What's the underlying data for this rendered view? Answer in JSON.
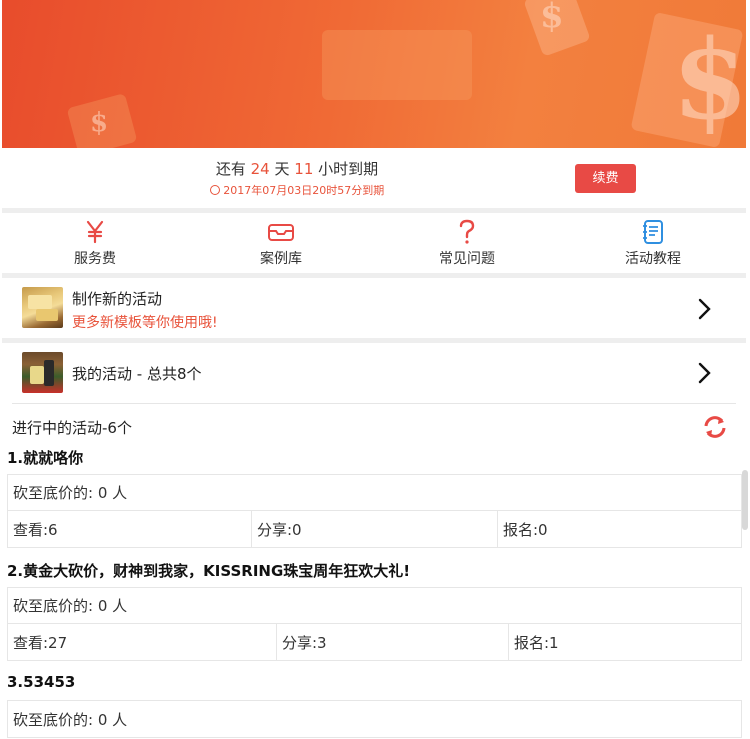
{
  "expiry": {
    "prefix": "还有",
    "days": "24",
    "day_unit": "天",
    "hours": "11",
    "suffix": "小时到期",
    "date_text": "2017年07月03日20时57分到期",
    "renew_label": "续费"
  },
  "nav": [
    {
      "label": "服务费",
      "icon": "yen-icon"
    },
    {
      "label": "案例库",
      "icon": "box-icon"
    },
    {
      "label": "常见问题",
      "icon": "question-icon"
    },
    {
      "label": "活动教程",
      "icon": "notebook-icon"
    }
  ],
  "create": {
    "title": "制作新的活动",
    "subtitle": "更多新模板等你使用哦!"
  },
  "mine": {
    "title": "我的活动 - 总共8个"
  },
  "ongoing": {
    "heading": "进行中的活动-6个"
  },
  "activities": [
    {
      "title": "1.就就咯你",
      "bottom": "砍至底价的: 0 人",
      "views": "查看:6",
      "shares": "分享:0",
      "signups": "报名:0"
    },
    {
      "title": "2.黄金大砍价，财神到我家，KISSRING珠宝周年狂欢大礼!",
      "bottom": "砍至底价的: 0 人",
      "views": "查看:27",
      "shares": "分享:3",
      "signups": "报名:1"
    },
    {
      "title": "3.53453",
      "bottom": "砍至底价的: 0 人"
    }
  ],
  "colors": {
    "accent": "#e8533b",
    "button": "#e84a45",
    "banner_start": "#e84c2c",
    "banner_end": "#f3803f"
  }
}
